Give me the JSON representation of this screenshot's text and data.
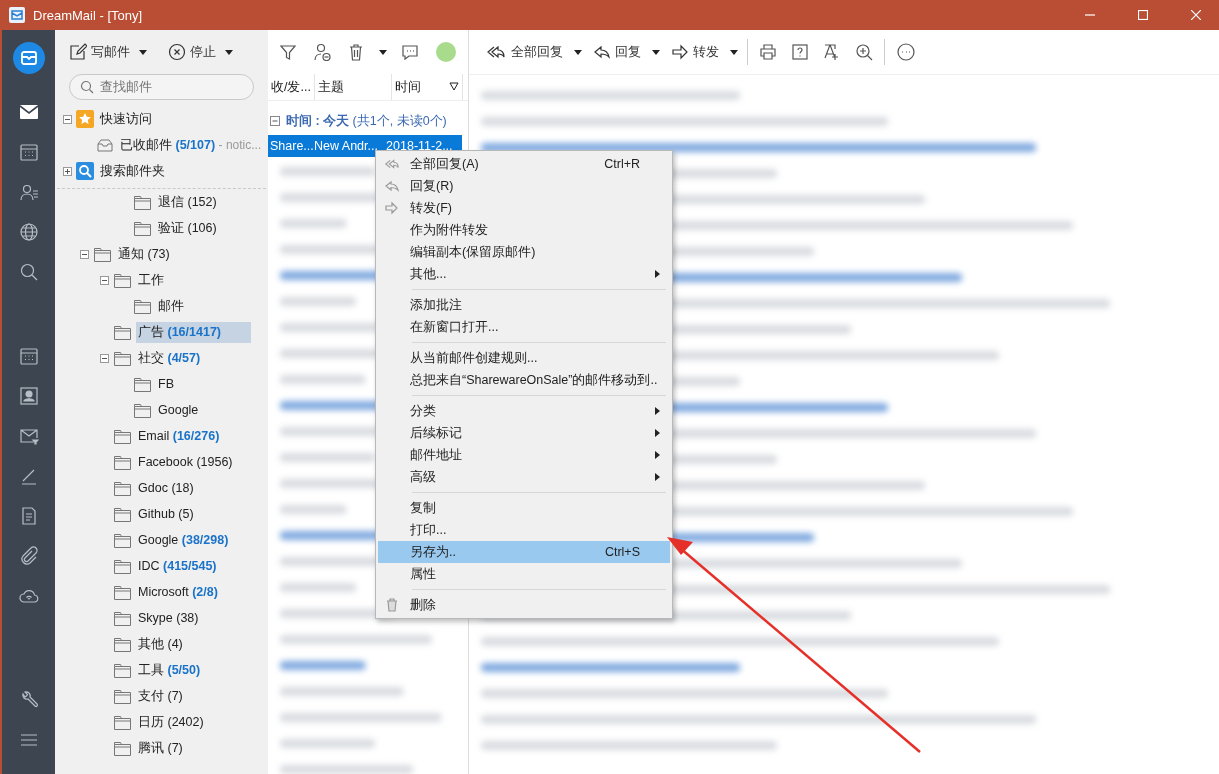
{
  "window": {
    "title": "DreamMail - [Tony]"
  },
  "rail": [
    {
      "kind": "mail",
      "selected": true
    },
    {
      "kind": "calendar",
      "selected": false
    },
    {
      "kind": "contacts",
      "selected": false
    },
    {
      "kind": "globe",
      "selected": false
    },
    {
      "kind": "search",
      "selected": false
    }
  ],
  "rail_bottom": [
    {
      "kind": "calendar"
    },
    {
      "kind": "contact_card"
    },
    {
      "kind": "mail_filter"
    },
    {
      "kind": "pen"
    },
    {
      "kind": "document"
    },
    {
      "kind": "paperclip"
    },
    {
      "kind": "cloud"
    }
  ],
  "rail_footer": [
    {
      "kind": "wrench"
    },
    {
      "kind": "menu"
    }
  ],
  "folder_toolbar": [
    {
      "kind": "compose",
      "label": "写邮件"
    },
    {
      "kind": "stop",
      "label": "停止"
    }
  ],
  "search": {
    "placeholder": "查找邮件"
  },
  "quick_tree": [
    {
      "kind": "star",
      "label": "快速访问",
      "expanded": true,
      "children": [
        {
          "kind": "inbox",
          "label": "已收邮件",
          "count": "(5/107)",
          "unread": true,
          "note": "- notic..."
        }
      ]
    },
    {
      "kind": "search",
      "label": "搜索邮件夹",
      "expanded": false
    }
  ],
  "cutoff_children": [
    {
      "label": "退信",
      "count": "(152)",
      "unread": false
    },
    {
      "label": "验证",
      "count": "(106)",
      "unread": false
    }
  ],
  "folder_tree": [
    {
      "label": "通知",
      "count": "(73)",
      "unread": false,
      "expanded": true,
      "selected": false,
      "children": [
        {
          "label": "工作",
          "expanded": true,
          "selected": false,
          "children": [
            {
              "label": "邮件",
              "selected": false
            }
          ]
        },
        {
          "label": "广告",
          "count": "(16/1417)",
          "unread": true,
          "selected": true
        },
        {
          "label": "社交",
          "count": "(4/57)",
          "unread": true,
          "expanded": true,
          "selected": false,
          "children": [
            {
              "label": "FB",
              "selected": false
            },
            {
              "label": "Google",
              "selected": false
            }
          ]
        },
        {
          "label": "Email",
          "count": "(16/276)",
          "unread": true,
          "selected": false
        },
        {
          "label": "Facebook",
          "count": "(1956)",
          "unread": false,
          "selected": false
        },
        {
          "label": "Gdoc",
          "count": "(18)",
          "unread": false,
          "selected": false
        },
        {
          "label": "Github",
          "count": "(5)",
          "unread": false,
          "selected": false
        },
        {
          "label": "Google",
          "count": "(38/298)",
          "unread": true,
          "selected": false
        },
        {
          "label": "IDC",
          "count": "(415/545)",
          "unread": true,
          "selected": false
        },
        {
          "label": "Microsoft",
          "count": "(2/8)",
          "unread": true,
          "selected": false
        },
        {
          "label": "Skype",
          "count": "(38)",
          "unread": false,
          "selected": false
        },
        {
          "label": "其他",
          "count": "(4)",
          "unread": false,
          "selected": false
        },
        {
          "label": "工具",
          "count": "(5/50)",
          "unread": true,
          "selected": false
        },
        {
          "label": "支付",
          "count": "(7)",
          "unread": false,
          "selected": false
        },
        {
          "label": "日历",
          "count": "(2402)",
          "unread": false,
          "selected": false
        },
        {
          "label": "腾讯",
          "count": "(7)",
          "unread": false,
          "selected": false
        }
      ]
    }
  ],
  "list_toolbar": [
    {
      "kind": "filter"
    },
    {
      "kind": "contact_remove"
    },
    {
      "kind": "trash"
    },
    {
      "kind": "chat"
    },
    {
      "kind": "status"
    }
  ],
  "message_list": {
    "columns": [
      "收/发...",
      "主题",
      "时间"
    ],
    "group": "**时间 : 今天** (共1个, 未读0个)",
    "group_expanded": true,
    "rows": [
      {
        "cells": [
          "Share...",
          "New Andr...",
          "2018-11-2..."
        ],
        "selected": true
      }
    ]
  },
  "reader_toolbar": [
    {
      "kind": "reply_all",
      "label": "全部回复"
    },
    {
      "kind": "reply",
      "label": "回复"
    },
    {
      "kind": "forward",
      "label": "转发"
    },
    {
      "kind": "print"
    },
    {
      "kind": "help"
    },
    {
      "kind": "font"
    },
    {
      "kind": "zoom"
    },
    {
      "kind": "more"
    }
  ],
  "context_menu": [
    {
      "kind": "reply_all",
      "label": "全部回复(A)",
      "shortcut": "Ctrl+R",
      "submenu": false,
      "selected": false
    },
    {
      "kind": "reply",
      "label": "回复(R)",
      "submenu": false,
      "selected": false
    },
    {
      "kind": "forward",
      "label": "转发(F)",
      "submenu": false,
      "selected": false
    },
    {
      "kind": "plain",
      "label": "作为附件转发",
      "submenu": false,
      "selected": false
    },
    {
      "kind": "plain",
      "label": "编辑副本(保留原邮件)",
      "submenu": false,
      "selected": false
    },
    {
      "kind": "plain",
      "label": "其他...",
      "submenu": true,
      "selected": false
    },
    {
      "kind": "separator"
    },
    {
      "kind": "plain",
      "label": "添加批注",
      "submenu": false,
      "selected": false
    },
    {
      "kind": "plain",
      "label": "在新窗口打开...",
      "submenu": false,
      "selected": false
    },
    {
      "kind": "separator"
    },
    {
      "kind": "plain",
      "label": "从当前邮件创建规则...",
      "submenu": false,
      "selected": false
    },
    {
      "kind": "plain",
      "label": "总把来自“SharewareOnSale”的邮件移动到..",
      "submenu": false,
      "selected": false
    },
    {
      "kind": "separator"
    },
    {
      "kind": "plain",
      "label": "分类",
      "submenu": true,
      "selected": false
    },
    {
      "kind": "plain",
      "label": "后续标记",
      "submenu": true,
      "selected": false
    },
    {
      "kind": "plain",
      "label": "邮件地址",
      "submenu": true,
      "selected": false
    },
    {
      "kind": "plain",
      "label": "高级",
      "submenu": true,
      "selected": false
    },
    {
      "kind": "separator"
    },
    {
      "kind": "plain",
      "label": "复制",
      "submenu": false,
      "selected": false
    },
    {
      "kind": "plain",
      "label": "打印...",
      "submenu": false,
      "selected": false
    },
    {
      "kind": "plain",
      "label": "另存为..",
      "shortcut": "Ctrl+S",
      "submenu": false,
      "selected": true
    },
    {
      "kind": "plain",
      "label": "属性",
      "submenu": false,
      "selected": false
    },
    {
      "kind": "separator"
    },
    {
      "kind": "delete",
      "label": "删除",
      "submenu": false,
      "selected": false
    }
  ]
}
